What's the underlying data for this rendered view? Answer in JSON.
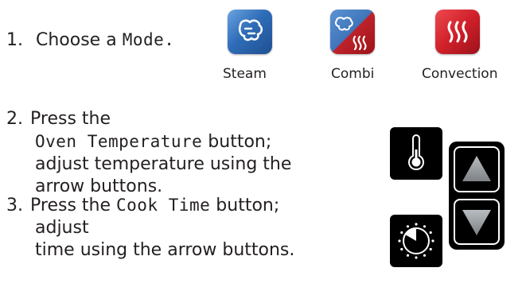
{
  "steps": {
    "step1": {
      "number": "1.",
      "text": "Choose a",
      "highlight": "Mode."
    },
    "step2": {
      "number": "2.",
      "line1": "Press the",
      "highlight": "Oven Temperature",
      "line2_rest": " button;",
      "line3": "adjust temperature using the",
      "line4": "arrow buttons."
    },
    "step3": {
      "number": "3.",
      "pre": "Press the ",
      "highlight": "Cook Time",
      "post": " button;",
      "line2": "adjust",
      "line3": "time using the arrow buttons."
    }
  },
  "modes": [
    {
      "label": "Steam",
      "icon": "steam-icon",
      "color": "#2f6db8"
    },
    {
      "label": "Combi",
      "icon": "combi-icon",
      "color": "#c8232c"
    },
    {
      "label": "Convection",
      "icon": "convection-icon",
      "color": "#d0202a"
    }
  ],
  "controls": {
    "temperature_icon": "thermometer-icon",
    "time_icon": "timer-dial-icon",
    "up_icon": "up-arrow-icon",
    "down_icon": "down-arrow-icon"
  },
  "colors": {
    "steam_blue": "#2f6db8",
    "convection_red": "#d0202a",
    "button_black": "#000000",
    "arrow_gray": "#8d9196"
  }
}
